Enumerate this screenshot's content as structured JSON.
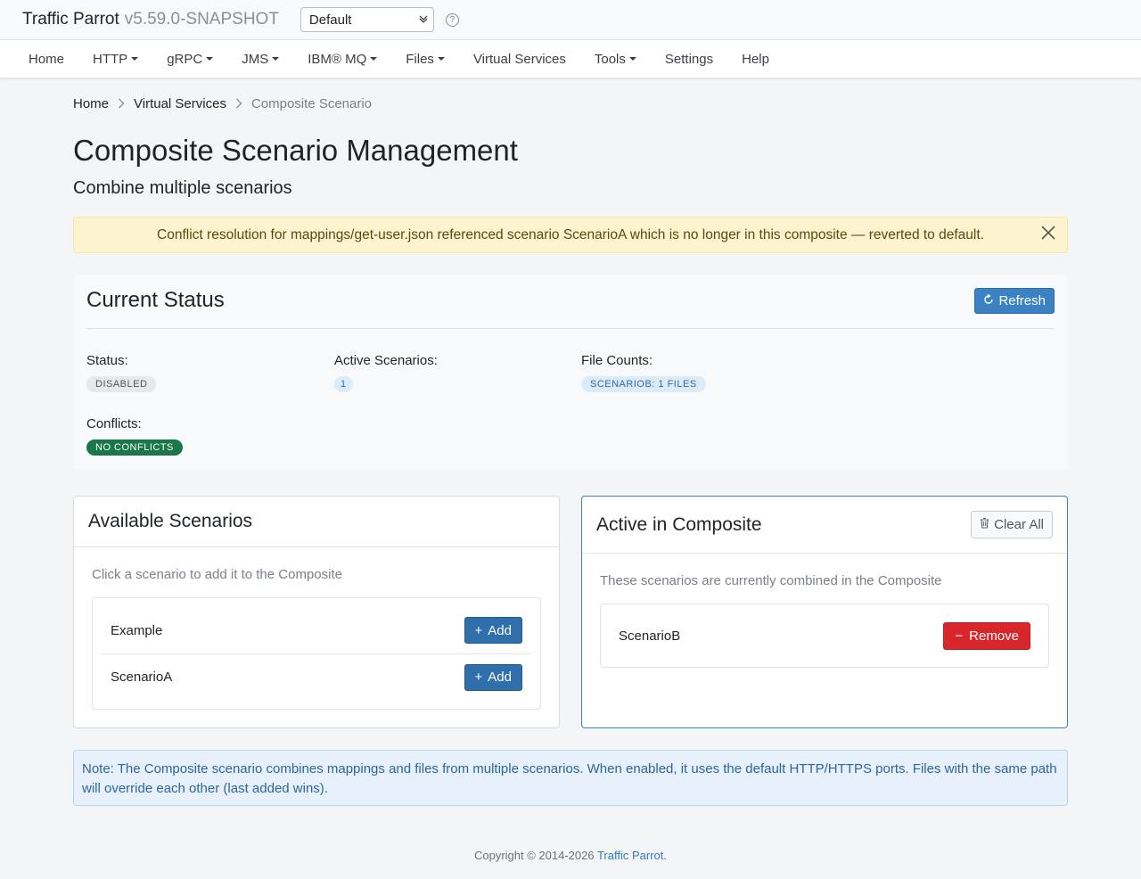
{
  "topbar": {
    "brand": "Traffic Parrot",
    "version": "v5.59.0-SNAPSHOT",
    "environment": "Default"
  },
  "nav": {
    "home": "Home",
    "http": "HTTP",
    "grpc": "gRPC",
    "jms": "JMS",
    "ibmmq": "IBM® MQ",
    "files": "Files",
    "virtual_services": "Virtual Services",
    "tools": "Tools",
    "settings": "Settings",
    "help": "Help"
  },
  "breadcrumb": {
    "home": "Home",
    "virtual_services": "Virtual Services",
    "current": "Composite Scenario"
  },
  "page": {
    "title": "Composite Scenario Management",
    "subtitle": "Combine multiple scenarios"
  },
  "alert": {
    "message": "Conflict resolution for mappings/get-user.json referenced scenario ScenarioA which is no longer in this composite — reverted to default."
  },
  "status": {
    "heading": "Current Status",
    "refresh_label": "Refresh",
    "status_label": "Status:",
    "status_value": "DISABLED",
    "active_label": "Active Scenarios:",
    "active_value": "1",
    "files_label": "File Counts:",
    "files_value": "SCENARIOB: 1 FILES",
    "conflicts_label": "Conflicts:",
    "conflicts_value": "NO CONFLICTS"
  },
  "available": {
    "heading": "Available Scenarios",
    "note": "Click a scenario to add it to the Composite",
    "items": [
      {
        "name": "Example",
        "button": "Add"
      },
      {
        "name": "ScenarioA",
        "button": "Add"
      }
    ]
  },
  "active": {
    "heading": "Active in Composite",
    "clear_label": "Clear All",
    "note": "These scenarios are currently combined in the Composite",
    "items": [
      {
        "name": "ScenarioB",
        "button": "Remove"
      }
    ]
  },
  "info": {
    "note": "Note: The Composite scenario combines mappings and files from multiple scenarios. When enabled, it uses the default HTTP/HTTPS ports. Files with the same path will override each other (last added wins)."
  },
  "footer": {
    "copyright": "Copyright © 2014-2026",
    "company": "Traffic Parrot",
    "period": "."
  },
  "colors": {
    "primary": "#3b82c4",
    "danger": "#d9262c",
    "success": "#19774a",
    "warning_bg": "#fdf3cf"
  }
}
